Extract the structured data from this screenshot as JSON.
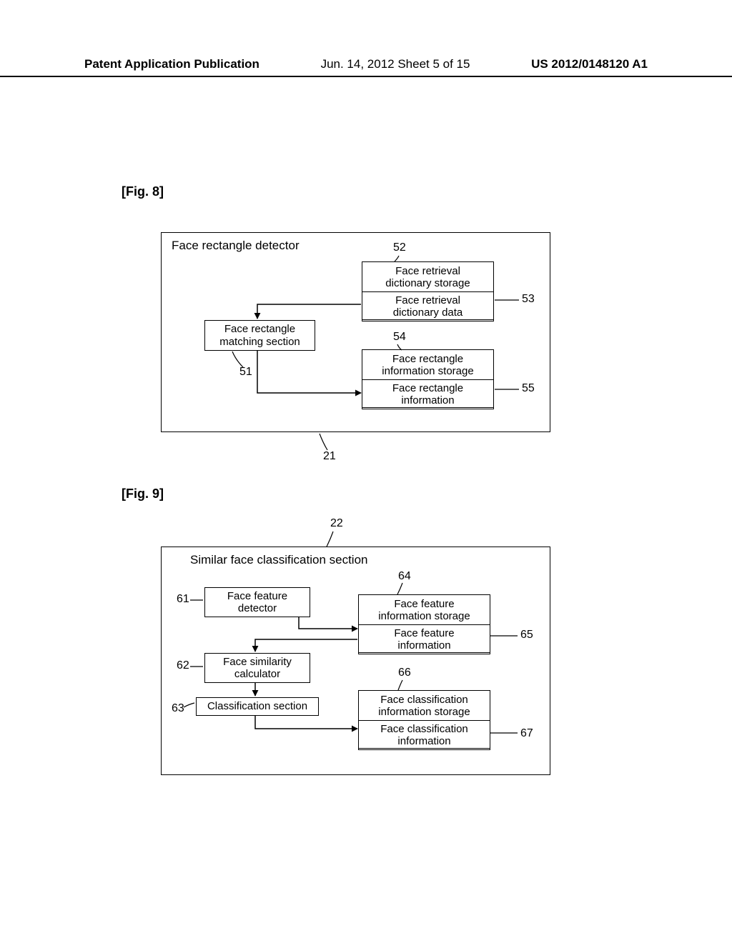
{
  "header": {
    "left": "Patent Application Publication",
    "mid": "Jun. 14, 2012  Sheet 5 of 15",
    "right": "US 2012/0148120 A1"
  },
  "fig8": {
    "label": "[Fig. 8]",
    "outer_title": "Face rectangle detector",
    "matching_section": "Face rectangle\nmatching section",
    "retrieval_storage": "Face retrieval\ndictionary storage",
    "retrieval_data": "Face retrieval\ndictionary data",
    "rect_info_storage": "Face rectangle\ninformation storage",
    "rect_info": "Face rectangle\ninformation",
    "ref21": "21",
    "ref51": "51",
    "ref52": "52",
    "ref53": "53",
    "ref54": "54",
    "ref55": "55"
  },
  "fig9": {
    "label": "[Fig. 9]",
    "outer_title": "Similar face classification section",
    "feature_detector": "Face feature\ndetector",
    "similarity_calc": "Face similarity\ncalculator",
    "classification_section": "Classification section",
    "feature_storage": "Face feature\ninformation storage",
    "feature_info": "Face feature\ninformation",
    "class_storage": "Face classification\ninformation storage",
    "class_info": "Face classification\ninformation",
    "ref22": "22",
    "ref61": "61",
    "ref62": "62",
    "ref63": "63",
    "ref64": "64",
    "ref65": "65",
    "ref66": "66",
    "ref67": "67"
  }
}
